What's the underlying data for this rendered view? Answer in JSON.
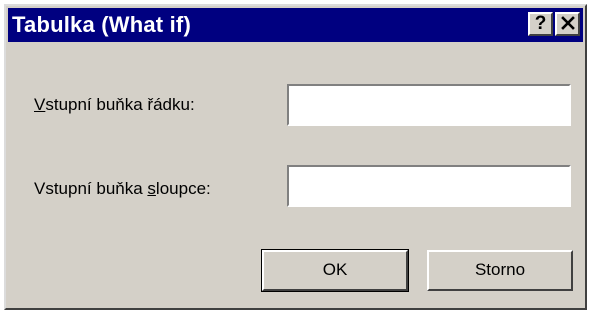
{
  "window": {
    "title": "Tabulka (What if)",
    "help_glyph": "?",
    "close_icon": "close-icon",
    "title_bg": "#000080",
    "face_color": "#d4d0c8"
  },
  "row_input": {
    "label_accel": "V",
    "label_rest": "stupní buňka řádku:",
    "value": ""
  },
  "col_input": {
    "label_before": "Vstupní buňka ",
    "label_accel": "s",
    "label_rest": "loupce:",
    "value": ""
  },
  "buttons": {
    "ok": "OK",
    "cancel": "Storno"
  }
}
